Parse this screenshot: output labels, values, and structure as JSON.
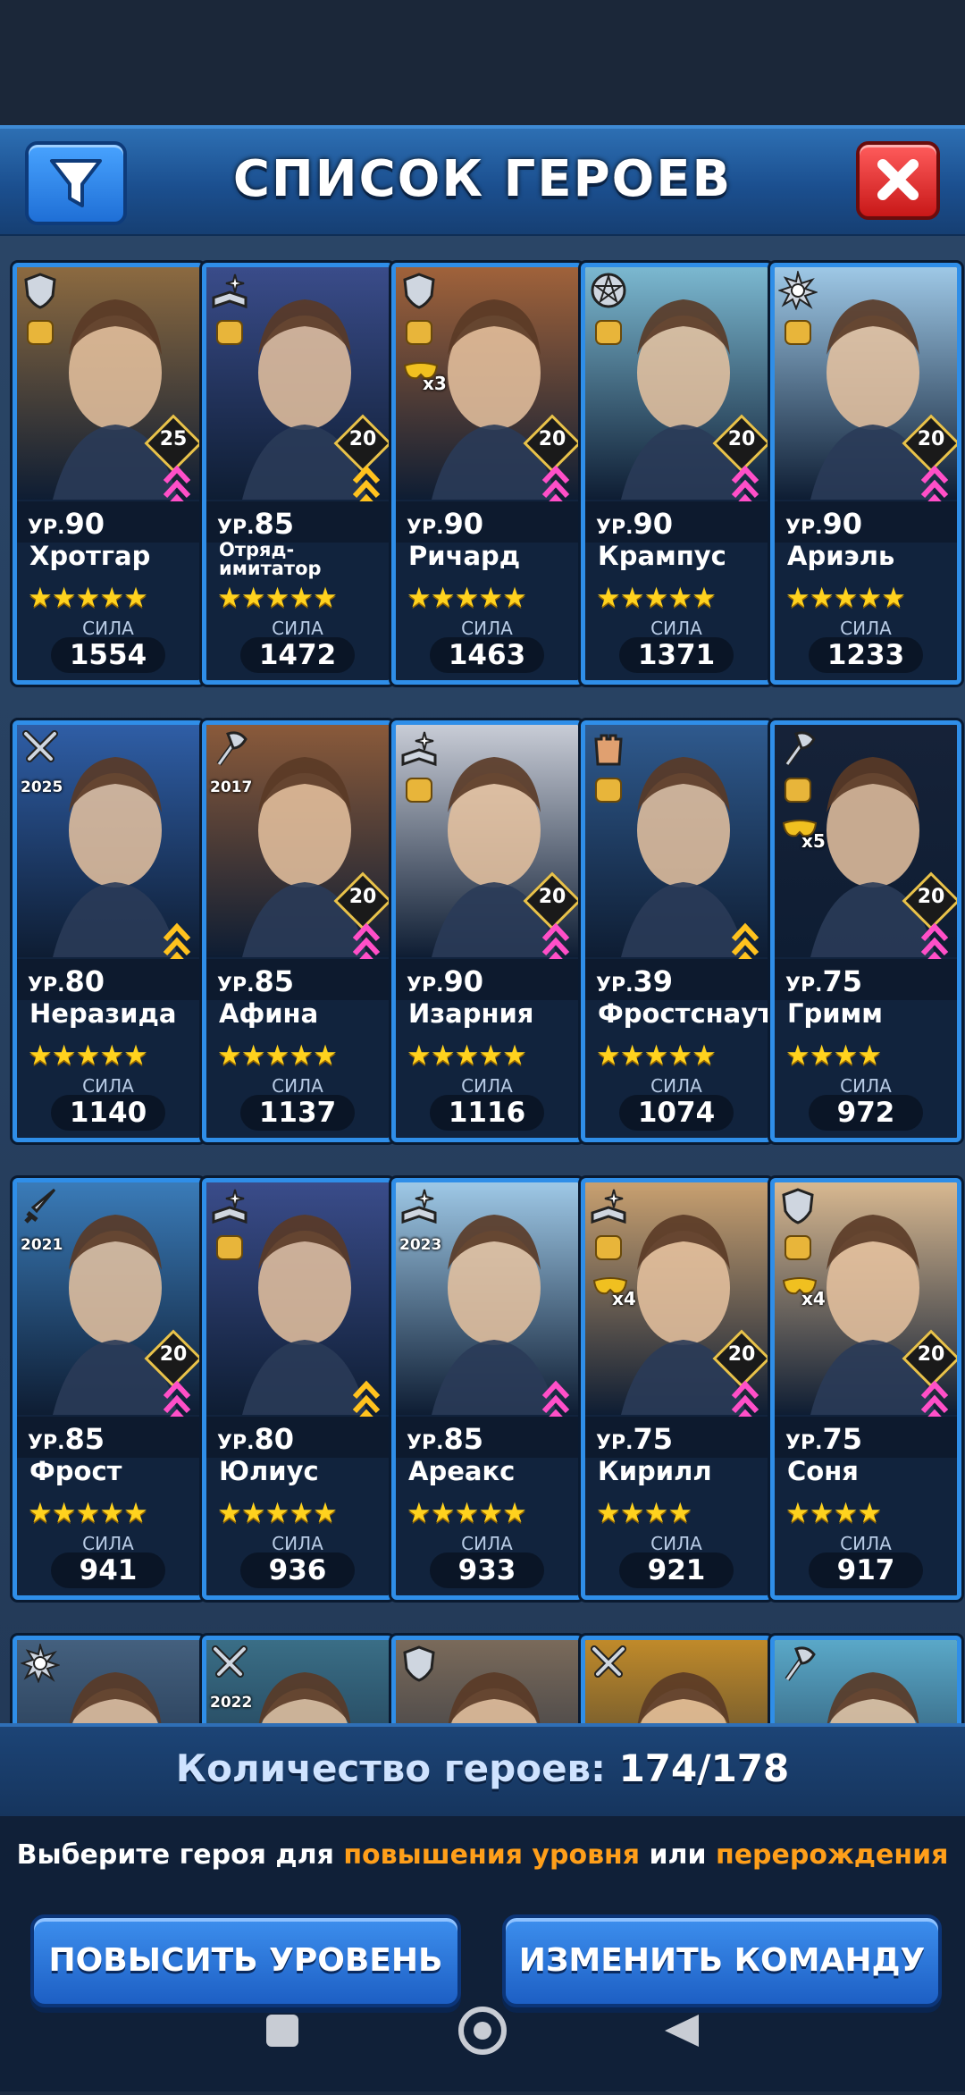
{
  "header": {
    "title": "СПИСОК ГЕРОЕВ"
  },
  "level_prefix": "УР.",
  "power_label": "СИЛА",
  "heroes": [
    {
      "name": "Хротгар",
      "level": "90",
      "power": "1554",
      "stars": "★★★★★",
      "rank": "25",
      "role": "shield-icon",
      "accent": "#8c6a40",
      "chevron": "pink"
    },
    {
      "name": "Отряд-имитатор",
      "level": "85",
      "power": "1472",
      "stars": "★★★★★",
      "rank": "20",
      "role": "book-icon",
      "accent": "#3a4c8a",
      "chevron": "gold"
    },
    {
      "name": "Ричард",
      "level": "90",
      "power": "1463",
      "stars": "★★★★★",
      "rank": "20",
      "role": "shield-icon",
      "accent": "#a0623a",
      "chevron": "pink",
      "mult": "x3"
    },
    {
      "name": "Крампус",
      "level": "90",
      "power": "1371",
      "stars": "★★★★★",
      "rank": "20",
      "role": "pentagram-icon",
      "accent": "#7bb8d0",
      "chevron": "pink"
    },
    {
      "name": "Ариэль",
      "level": "90",
      "power": "1233",
      "stars": "★★★★★",
      "rank": "20",
      "role": "sun-icon",
      "accent": "#9ec8e6",
      "chevron": "pink"
    },
    {
      "name": "Неразида",
      "level": "80",
      "power": "1140",
      "stars": "★★★★★",
      "rank": "",
      "role": "swords-icon",
      "accent": "#2f5ea6",
      "chevron": "gold",
      "year": "2025"
    },
    {
      "name": "Афина",
      "level": "85",
      "power": "1137",
      "stars": "★★★★★",
      "rank": "20",
      "role": "axe-icon",
      "accent": "#8a5a3a",
      "chevron": "pink",
      "year": "2017"
    },
    {
      "name": "Изарния",
      "level": "90",
      "power": "1116",
      "stars": "★★★★★",
      "rank": "20",
      "role": "book-icon",
      "accent": "#c8ccd6",
      "chevron": "pink"
    },
    {
      "name": "Фростснаут",
      "level": "39",
      "power": "1074",
      "stars": "★★★★★",
      "rank": "",
      "role": "tower-icon",
      "accent": "#2f5a8e",
      "chevron": "gold"
    },
    {
      "name": "Гримм",
      "level": "75",
      "power": "972",
      "stars": "★★★★",
      "rank": "20",
      "role": "axe-icon",
      "accent": "#162238",
      "chevron": "pink",
      "mult": "x5"
    },
    {
      "name": "Фрост",
      "level": "85",
      "power": "941",
      "stars": "★★★★★",
      "rank": "20",
      "role": "dagger-icon",
      "accent": "#3a7bb8",
      "chevron": "pink",
      "year": "2021"
    },
    {
      "name": "Юлиус",
      "level": "80",
      "power": "936",
      "stars": "★★★★★",
      "rank": "",
      "role": "book-icon",
      "accent": "#3a4c8a",
      "chevron": "gold"
    },
    {
      "name": "Ареакс",
      "level": "85",
      "power": "933",
      "stars": "★★★★★",
      "rank": "",
      "role": "book-icon",
      "accent": "#9ec8e6",
      "chevron": "pink",
      "year": "2023"
    },
    {
      "name": "Кирилл",
      "level": "75",
      "power": "921",
      "stars": "★★★★",
      "rank": "20",
      "role": "book-icon",
      "accent": "#c8a070",
      "chevron": "pink",
      "mult": "x4"
    },
    {
      "name": "Соня",
      "level": "75",
      "power": "917",
      "stars": "★★★★",
      "rank": "20",
      "role": "shield-icon",
      "accent": "#d8b890",
      "chevron": "pink",
      "mult": "x4"
    }
  ],
  "partial_row": [
    {
      "role": "sun-icon",
      "accent": "#44607e"
    },
    {
      "role": "swords-icon",
      "accent": "#3a6e86",
      "year": "2022"
    },
    {
      "role": "shield-icon",
      "accent": "#7a6a5a"
    },
    {
      "role": "swords-icon",
      "accent": "#c08a2a"
    },
    {
      "role": "axe-icon",
      "accent": "#5aa8c8"
    }
  ],
  "footer": {
    "count_label": "Количество героев:",
    "count_value": "174/178",
    "hint_pre": "Выберите героя для",
    "hint_hl1": "повышения уровня",
    "hint_mid": "или",
    "hint_hl2": "перерождения",
    "btn_level_up": "ПОВЫСИТЬ УРОВЕНЬ",
    "btn_team": "ИЗМЕНИТЬ КОМАНДУ"
  },
  "colors": {
    "card_border": "#2f8ee8",
    "star": "#ffd21e",
    "highlight": "#ff9f1a",
    "close": "#d42020"
  }
}
